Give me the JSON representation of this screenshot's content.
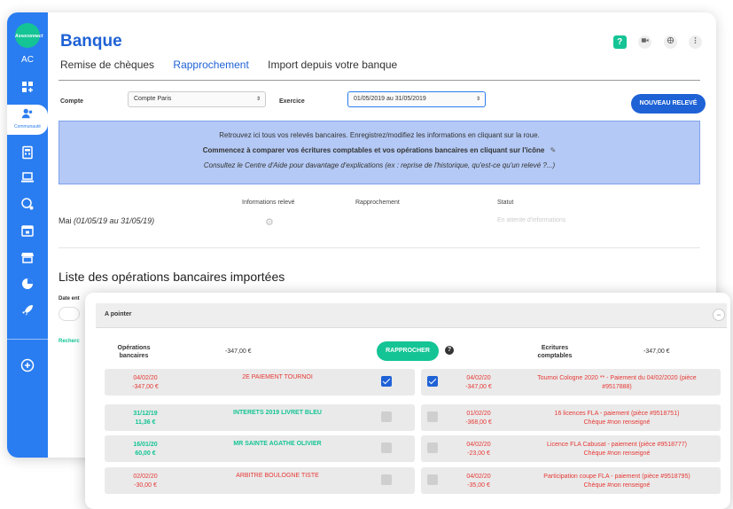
{
  "sidebar": {
    "logo_text": "Assoconnect",
    "initials": "AC",
    "active_item_caption": "Communauté",
    "icons": [
      "dashboard-icon",
      "community-icon",
      "calculator-icon",
      "laptop-icon",
      "chat-icon",
      "calendar-icon",
      "shop-icon",
      "pie-chart-icon",
      "rocket-icon",
      "plus-circle-icon"
    ]
  },
  "header": {
    "title": "Banque",
    "tabs": [
      {
        "label": "Remise de chèques",
        "active": false
      },
      {
        "label": "Rapprochement",
        "active": true
      },
      {
        "label": "Import depuis votre banque",
        "active": false
      }
    ],
    "help_label": "?"
  },
  "filters": {
    "compte_label": "Compte",
    "compte_value": "Compte Paris",
    "exercice_label": "Exercice",
    "exercice_value": "01/05/2019 au 31/05/2019",
    "new_button": "NOUVEAU RELEVÉ"
  },
  "info_box": {
    "line1": "Retrouvez ici tous vos relevés bancaires. Enregistrez/modifiez les informations en cliquant sur la roue.",
    "line2": "Commencez à comparer vos écritures comptables et vos opérations bancaires en cliquant sur l'icône",
    "line3": "Consultez le Centre d'Aide pour davantage d'explications (ex : reprise de l'historique, qu'est-ce qu'un relevé ?...)"
  },
  "releve_table": {
    "headers": [
      "Informations relevé",
      "Rapprochement",
      "Statut"
    ],
    "row": {
      "month": "Mai",
      "period": "(01/05/19 au 31/05/19)",
      "status": "En attente d'informations"
    }
  },
  "list": {
    "title": "Liste des opérations bancaires importées",
    "date_label": "Date ent",
    "search_label": "Recherc"
  },
  "pointer_panel": {
    "title": "A pointer",
    "collapse_symbol": "−",
    "ops_label": "Opérations bancaires",
    "ops_total": "-347,00 €",
    "rapprocher_button": "RAPPROCHER",
    "help_symbol": "?",
    "ecr_label": "Ecritures comptables",
    "ecr_total": "-347,00 €",
    "operations": [
      {
        "date": "04/02/20",
        "amount": "-347,00 €",
        "label": "2E PAIEMENT TOURNOI",
        "checked": true,
        "color": "red"
      },
      {
        "date": "31/12/19",
        "amount": "11,36 €",
        "label": "INTERETS 2019 LIVRET BLEU",
        "checked": false,
        "color": "green"
      },
      {
        "date": "16/01/20",
        "amount": "60,00 €",
        "label": "MR SAINTE AGATHE OLIVIER",
        "checked": false,
        "color": "green"
      },
      {
        "date": "02/02/20",
        "amount": "-30,00 €",
        "label": "ARBITRE BOULOGNE TISTE",
        "checked": false,
        "color": "red"
      }
    ],
    "ecritures": [
      {
        "date": "04/02/20",
        "amount": "-347,00 €",
        "line1": "Tournoi Cologne 2020 ** - Paiement du 04/02/2020 (pièce",
        "line2": "#9517888)",
        "checked": true
      },
      {
        "date": "01/02/20",
        "amount": "-368,00 €",
        "line1": "16 licences FLA - paiement (pièce #9518751)",
        "line2": "Chèque #non renseigné",
        "checked": false
      },
      {
        "date": "04/02/20",
        "amount": "-23,00 €",
        "line1": "Licence FLA Cabusat - paiement (pièce #9518777)",
        "line2": "Chèque #non renseigné",
        "checked": false
      },
      {
        "date": "04/02/20",
        "amount": "-35,00 €",
        "line1": "Participation coupe FLA - paiement (pièce #9518795)",
        "line2": "Chèque #non renseigné",
        "checked": false
      }
    ]
  }
}
